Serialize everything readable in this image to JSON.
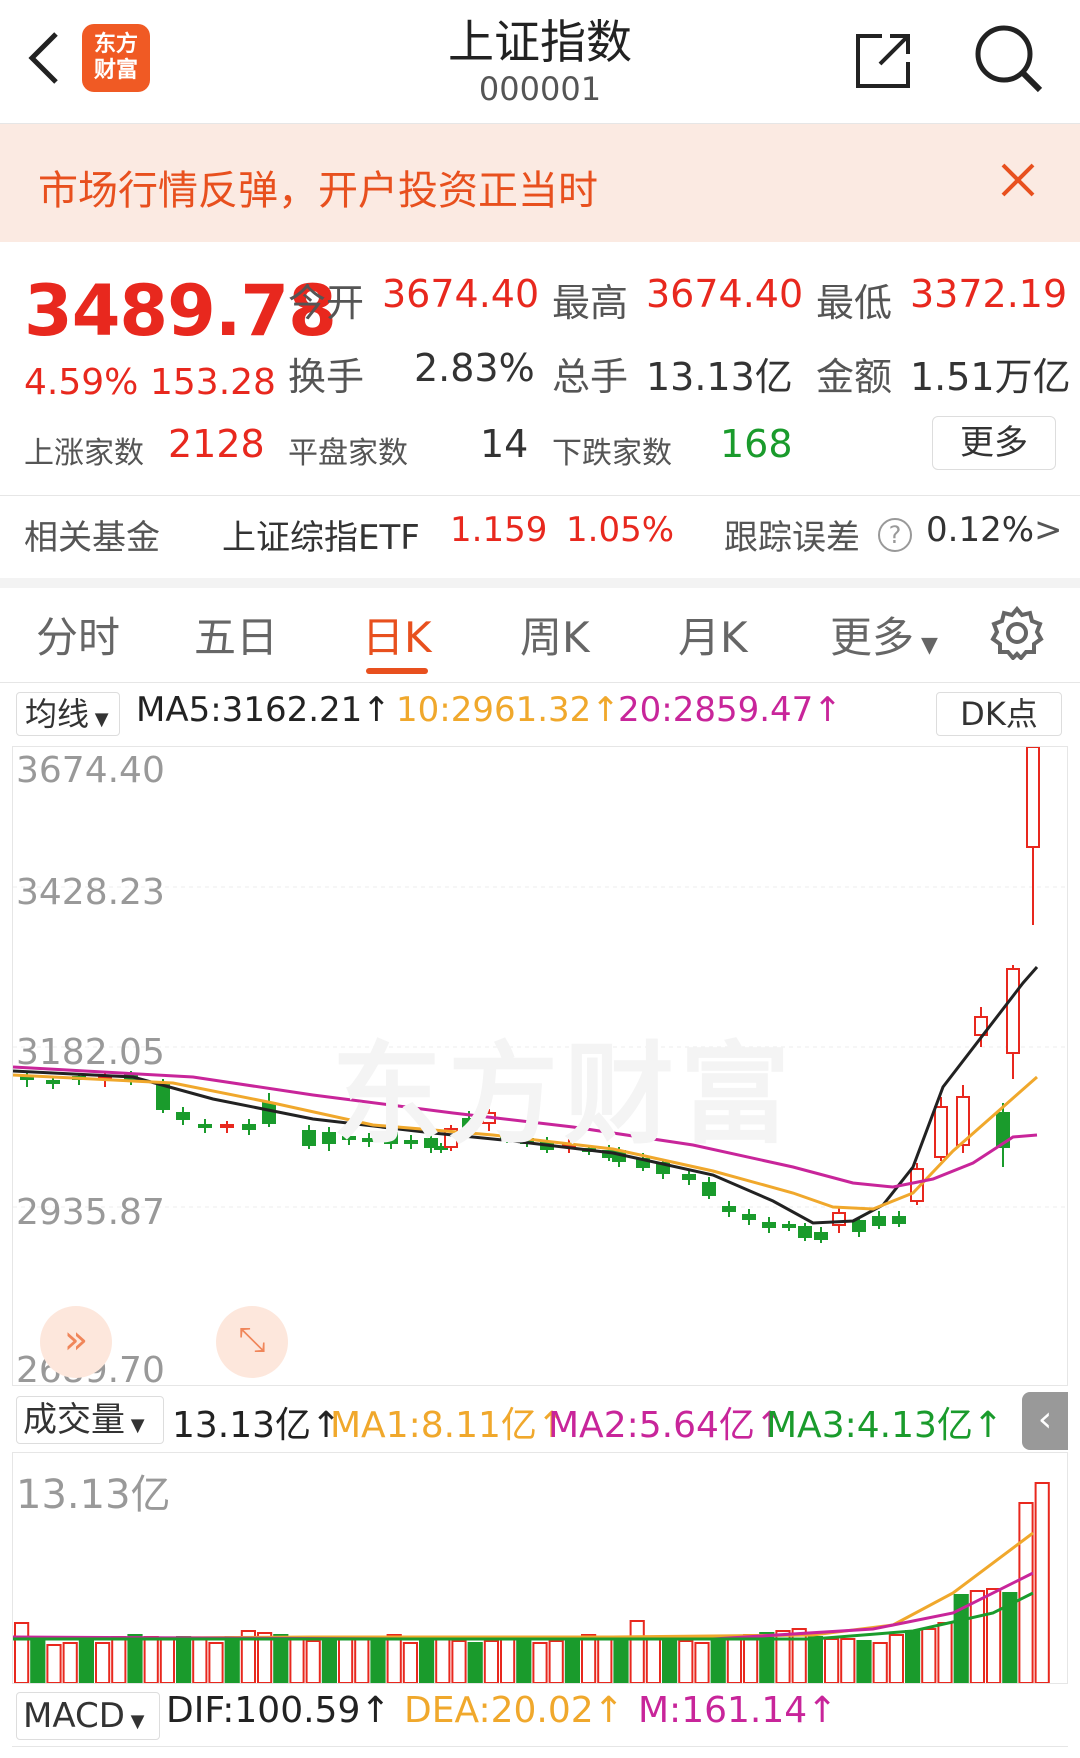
{
  "header": {
    "title": "上证指数",
    "code": "000001",
    "logo_text": "东方\n财富"
  },
  "banner": {
    "text": "市场行情反弹，开户投资正当时"
  },
  "quote": {
    "price": "3489.78",
    "pct": "4.59%",
    "change": "153.28",
    "open_label": "今开",
    "open": "3674.40",
    "high_label": "最高",
    "high": "3674.40",
    "low_label": "最低",
    "low": "3372.19",
    "turnover_label": "换手",
    "turnover": "2.83%",
    "vol_label": "总手",
    "vol": "13.13亿",
    "amount_label": "金额",
    "amount": "1.51万亿",
    "up_label": "上涨家数",
    "up": "2128",
    "flat_label": "平盘家数",
    "flat": "14",
    "down_label": "下跌家数",
    "down": "168",
    "more": "更多"
  },
  "fund": {
    "label": "相关基金",
    "name": "上证综指ETF",
    "price": "1.159",
    "pct": "1.05%",
    "err_label": "跟踪误差",
    "err": "0.12%",
    "arrow": ">"
  },
  "tabs": [
    "分时",
    "五日",
    "日K",
    "周K",
    "月K",
    "更多"
  ],
  "active_tab": "日K",
  "ma": {
    "selector": "均线",
    "ma5": "MA5:3162.21↑",
    "ma10": "10:2961.32↑",
    "ma20": "20:2859.47↑",
    "dk": "DK点"
  },
  "axis": {
    "top": "3674.40",
    "l2": "3428.23",
    "l3": "3182.05",
    "l4": "2935.87",
    "bottom": "2689.70"
  },
  "watermark": "东方财富",
  "volume": {
    "selector": "成交量",
    "val": "13.13亿↑",
    "ma1": "MA1:8.11亿↑",
    "ma2": "MA2:5.64亿↑",
    "ma3": "MA3:4.13亿↑",
    "axis_top": "13.13亿"
  },
  "macd": {
    "selector": "MACD",
    "dif": "DIF:100.59↑",
    "dea": "DEA:20.02↑",
    "m": "M:161.14↑"
  },
  "colors": {
    "up": "#e8281e",
    "down": "#1a9b2c",
    "accent": "#e8501e",
    "ma5": "#222222",
    "ma10": "#f0a82c",
    "ma20": "#c8259a"
  },
  "icons": [
    "back-icon",
    "share-icon",
    "search-icon",
    "close-icon",
    "gear-icon",
    "expand-icon",
    "fast-forward-icon",
    "help-icon"
  ]
}
